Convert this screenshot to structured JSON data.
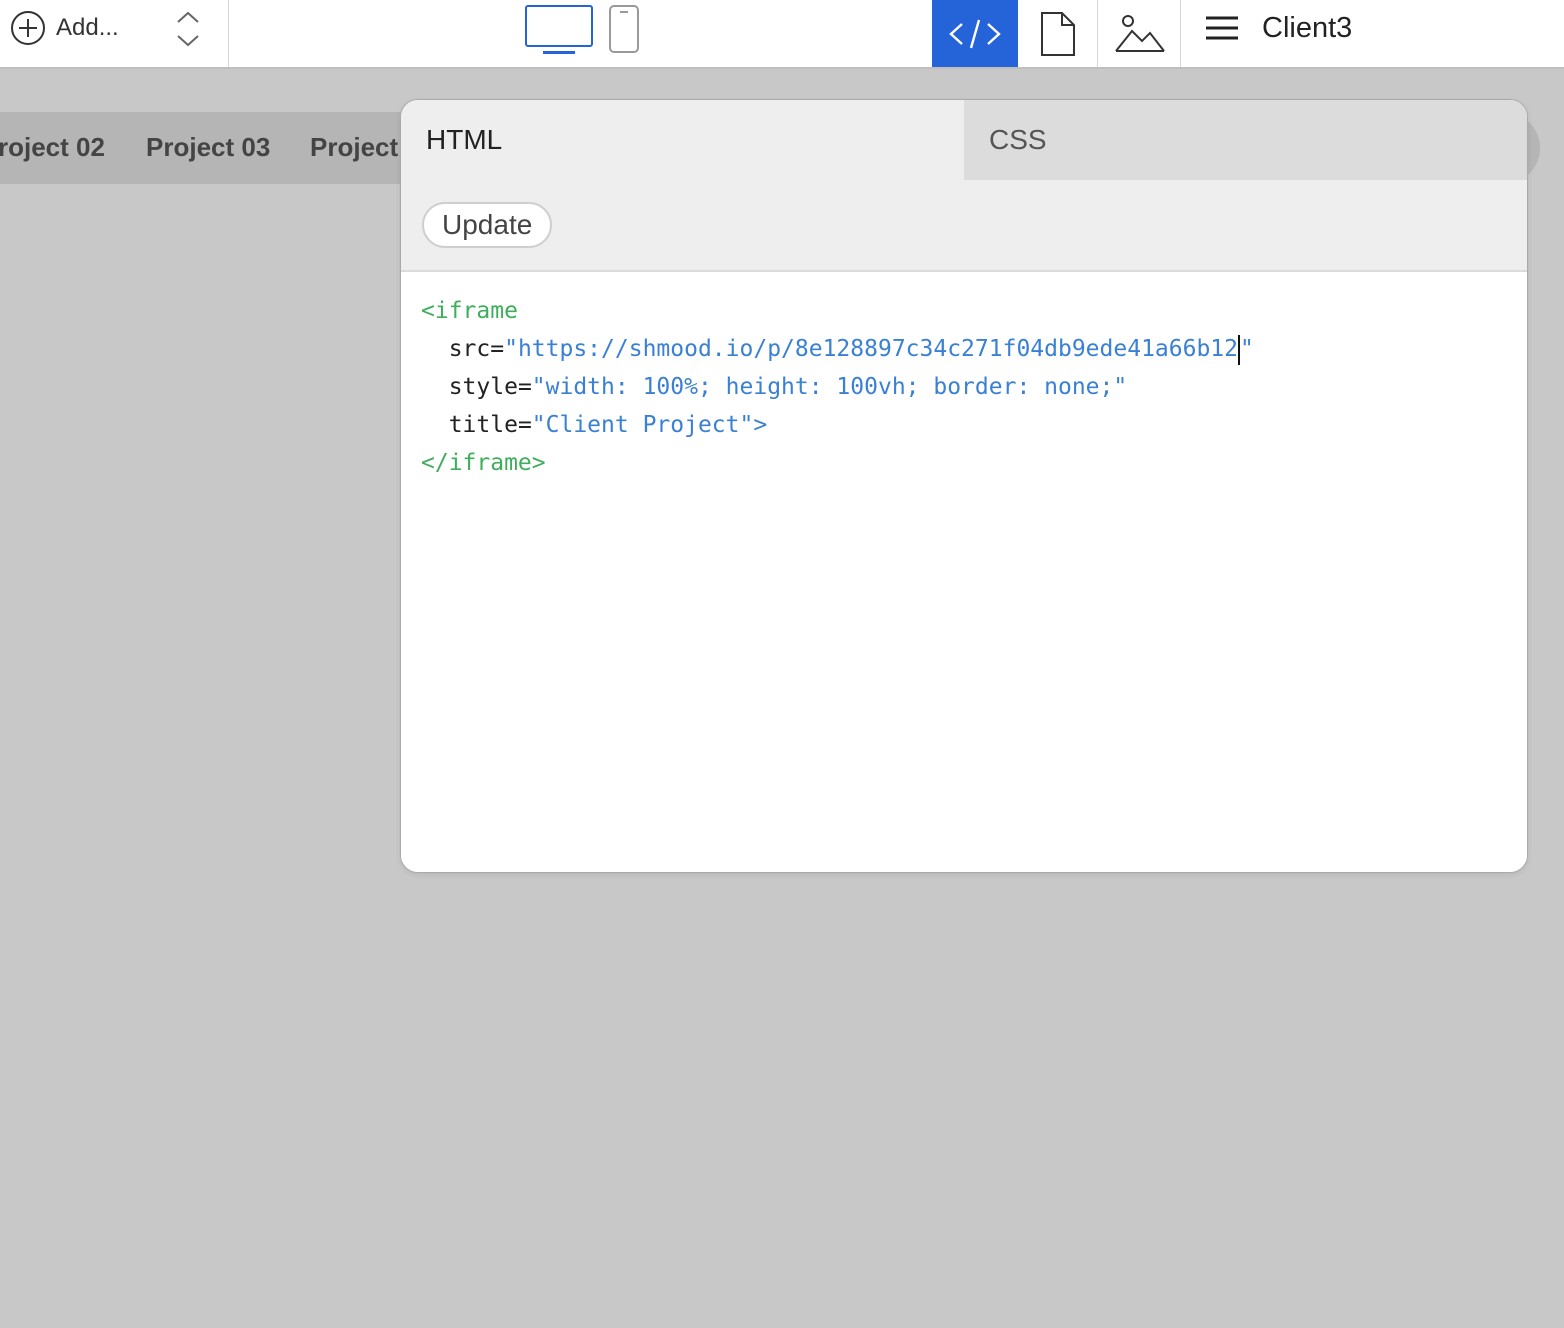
{
  "toolbar": {
    "add_label": "Add...",
    "client_name": "Client3",
    "accent_color": "#2563d9",
    "icons": [
      "plus-circle-icon",
      "up-down-chevron-icon",
      "desktop-icon",
      "mobile-icon",
      "code-icon",
      "page-icon",
      "image-icon",
      "hamburger-menu-icon"
    ]
  },
  "nav": {
    "items": [
      "roject 02",
      "Project 03",
      "Project"
    ]
  },
  "panel": {
    "tabs": [
      {
        "label": "HTML",
        "active": true
      },
      {
        "label": "CSS",
        "active": false
      }
    ],
    "update_label": "Update",
    "code": {
      "line1_tag": "<iframe",
      "line2_attr": "src=",
      "line2_value": "\"https://shmood.io/p/8e128897c34c271f04db9ede41a66b12",
      "line2_close": "\"",
      "line3_attr": "style=",
      "line3_value": "\"width: 100%; height: 100vh; border: none;\"",
      "line4_attr": "title=",
      "line4_value": "\"Client Project\">",
      "line5_tag": "</iframe>"
    },
    "syntax_colors": {
      "tag": "#3fae5c",
      "attribute": "#222222",
      "string": "#3a80d4"
    }
  }
}
